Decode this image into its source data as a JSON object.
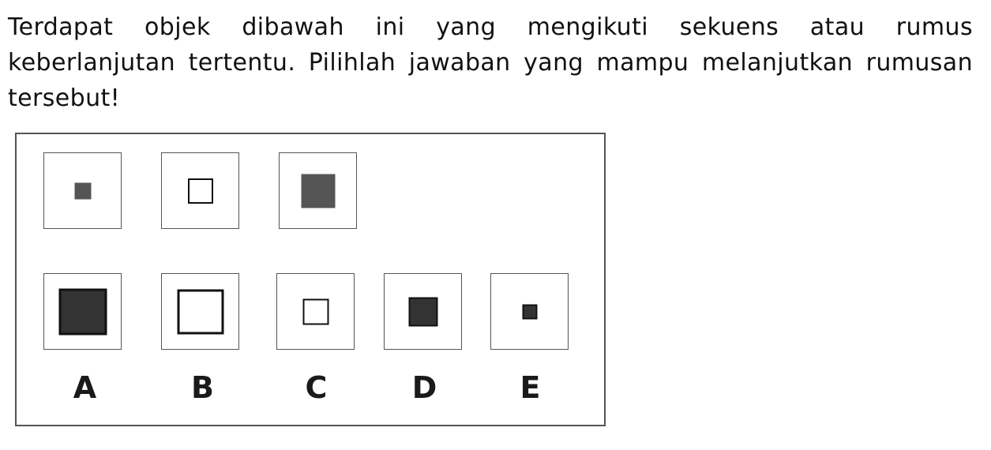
{
  "question": {
    "text": "Terdapat objek dibawah ini yang mengikuti sekuens atau rumus keberlanjutan tertentu. Pilihlah jawaban yang mampu melanjutkan rumusan tersebut!"
  },
  "sequence": [
    {
      "fill": "#555555",
      "border": "#555555",
      "size": "small"
    },
    {
      "fill": "#ffffff",
      "border": "#111111",
      "size": "small-medium"
    },
    {
      "fill": "#555555",
      "border": "#555555",
      "size": "medium"
    }
  ],
  "options": [
    {
      "label": "A",
      "fill": "#333333",
      "border": "#111111",
      "size": "large"
    },
    {
      "label": "B",
      "fill": "#ffffff",
      "border": "#111111",
      "size": "large"
    },
    {
      "label": "C",
      "fill": "#ffffff",
      "border": "#111111",
      "size": "small-medium"
    },
    {
      "label": "D",
      "fill": "#333333",
      "border": "#111111",
      "size": "medium-small"
    },
    {
      "label": "E",
      "fill": "#333333",
      "border": "#111111",
      "size": "small"
    }
  ]
}
